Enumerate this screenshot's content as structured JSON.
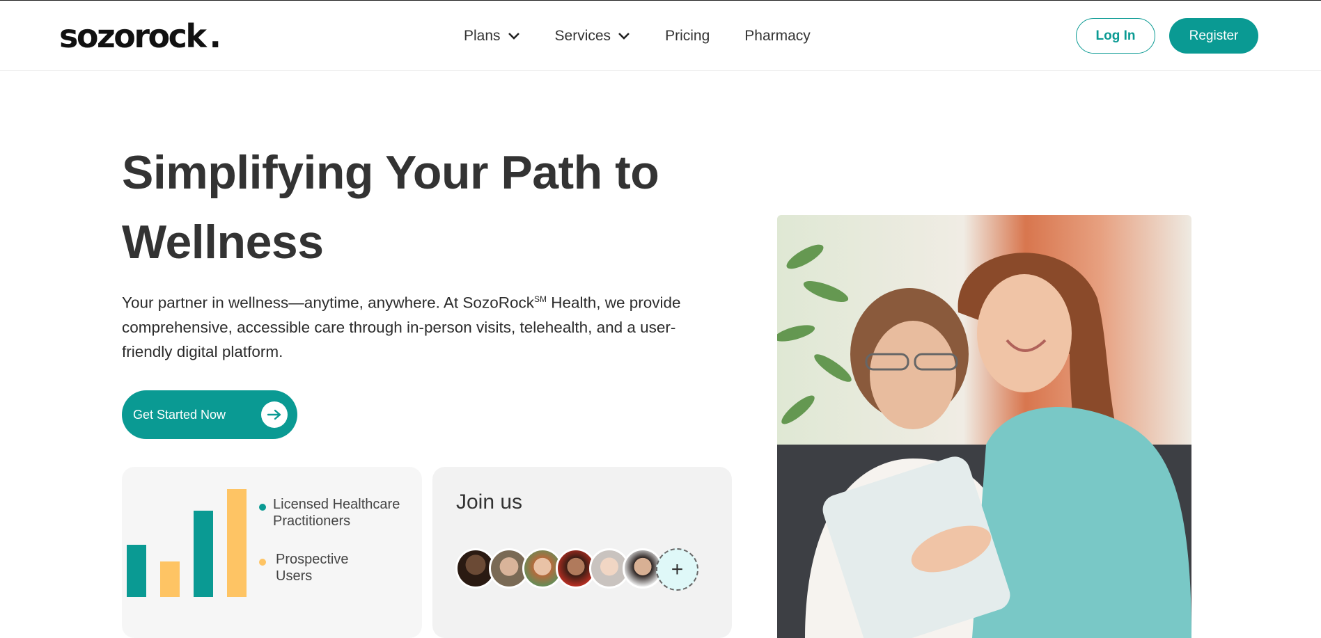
{
  "header": {
    "logo_text": "sozorock",
    "logo_dot": ".",
    "nav": [
      {
        "label": "Plans",
        "has_dropdown": true
      },
      {
        "label": "Services",
        "has_dropdown": true
      },
      {
        "label": "Pricing",
        "has_dropdown": false
      },
      {
        "label": "Pharmacy",
        "has_dropdown": false
      }
    ],
    "login_label": "Log In",
    "register_label": "Register"
  },
  "hero": {
    "title": "Simplifying Your Path to Wellness",
    "desc_part1": "Your partner in wellness—anytime, anywhere. At SozoRock",
    "desc_sup": "SM",
    "desc_part2": " Health, we provide comprehensive, accessible care through in-person visits, telehealth, and a user-friendly digital platform.",
    "cta_label": "Get Started Now"
  },
  "stats_card": {
    "legend": [
      {
        "label": "Licensed Healthcare Practitioners",
        "color": "#0a9a93"
      },
      {
        "label": "Prospective Users",
        "color": "#fec464"
      }
    ]
  },
  "join_card": {
    "title": "Join us",
    "add_symbol": "+"
  },
  "colors": {
    "accent": "#0a9a93",
    "secondary": "#fec464"
  }
}
